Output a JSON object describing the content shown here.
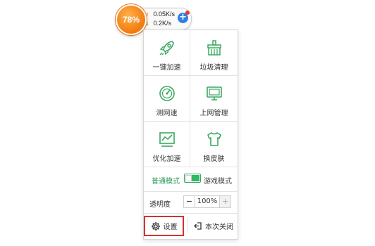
{
  "ball": {
    "percent": "78%"
  },
  "speed": {
    "upload": "0.05K/s",
    "download": "0.2K/s"
  },
  "tools": [
    {
      "label": "一键加速",
      "icon": "rocket-icon"
    },
    {
      "label": "垃圾清理",
      "icon": "broom-icon"
    },
    {
      "label": "测网速",
      "icon": "speedometer-icon"
    },
    {
      "label": "上网管理",
      "icon": "monitor-icon"
    },
    {
      "label": "优化加速",
      "icon": "chart-line-icon"
    },
    {
      "label": "换皮肤",
      "icon": "tshirt-icon"
    }
  ],
  "mode": {
    "normal": "普通模式",
    "game": "游戏模式"
  },
  "transparency": {
    "label": "透明度",
    "value": "100%",
    "minus": "−",
    "plus": "+"
  },
  "bottom": {
    "settings": "设置",
    "close": "本次关闭"
  },
  "colors": {
    "accent": "#2fb866",
    "orange": "#f27a0f",
    "highlight": "#d3322f",
    "icon": "#3aa860"
  }
}
